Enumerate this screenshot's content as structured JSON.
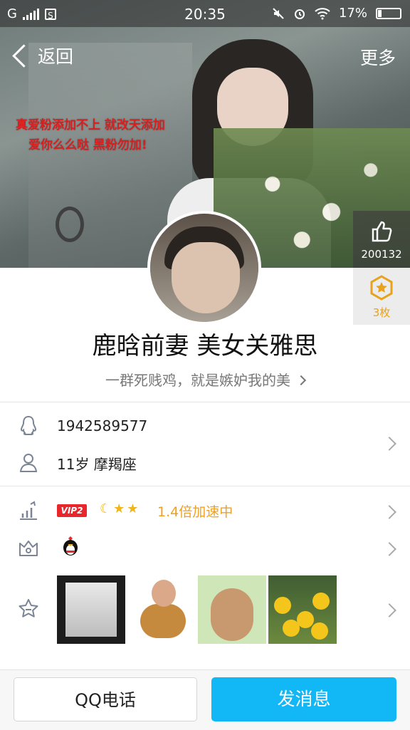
{
  "status_bar": {
    "network": "G",
    "sim_icon": "S",
    "time": "20:35",
    "battery": "17%"
  },
  "header": {
    "back_label": "返回",
    "more_label": "更多",
    "banner_caption_line1": "真爱粉添加不上 就改天添加",
    "banner_caption_line2": "爱你么么哒 黑粉勿加!"
  },
  "like": {
    "count": "200132"
  },
  "medal": {
    "count": "3枚"
  },
  "profile": {
    "nickname": "鹿晗前妻 美女关雅思",
    "signature": "一群死贱鸡，就是嫉妒我的美"
  },
  "info": {
    "qq_number": "1942589577",
    "age_zodiac": "11岁  摩羯座"
  },
  "level": {
    "vip_label": "VIP2",
    "speed_text": "1.4倍加速中"
  },
  "icons": {
    "qq_icon": "penguin-icon",
    "user_icon": "user-icon",
    "level_icon": "bars-icon",
    "crown_icon": "crown-icon",
    "star_icon": "star-icon"
  },
  "actions": {
    "call_label": "QQ电话",
    "message_label": "发消息"
  },
  "colors": {
    "accent": "#12b7f5",
    "vip_red": "#e8262c",
    "speed_orange": "#f0a020",
    "caption_red": "#d62020"
  }
}
